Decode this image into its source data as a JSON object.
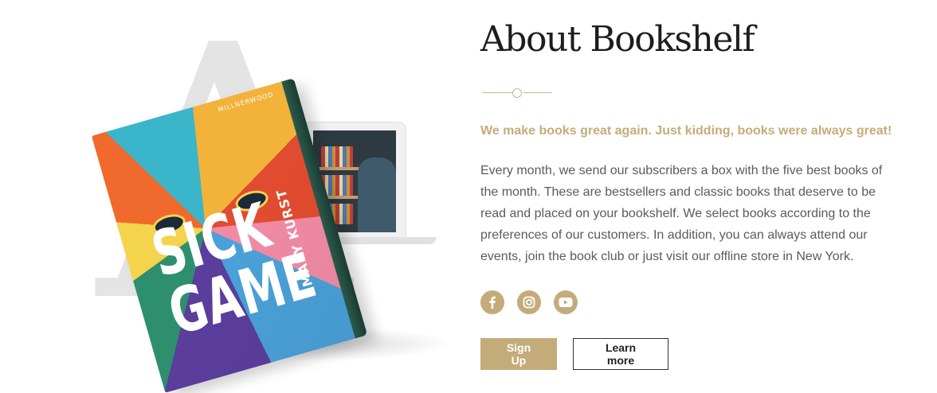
{
  "about": {
    "heading": "About Bookshelf",
    "tagline": "We make books great again. Just kidding, books were always great!",
    "body": "Every month, we send our subscribers a box with the five best books of the month. These are bestsellers and classic books that deserve to be read and placed on your bookshelf. We select books according to the preferences of our customers. In addition, you can always attend our events, join the book club or just visit our offline store in New York.",
    "signup_label": "Sign Up",
    "learn_more_label": "Learn more"
  },
  "illustration": {
    "background_letter": "A",
    "book_title_line1": "SICK",
    "book_title_line2": "GAME",
    "book_author": "MARY KURST",
    "book_publisher": "MILLNERWOOD"
  },
  "socials": [
    {
      "name": "facebook-icon"
    },
    {
      "name": "instagram-icon"
    },
    {
      "name": "youtube-icon"
    }
  ],
  "colors": {
    "accent": "#c4ac7a",
    "heading": "#1d1d1d",
    "body_text": "#5b5b5b",
    "divider": "#c8b68f"
  }
}
